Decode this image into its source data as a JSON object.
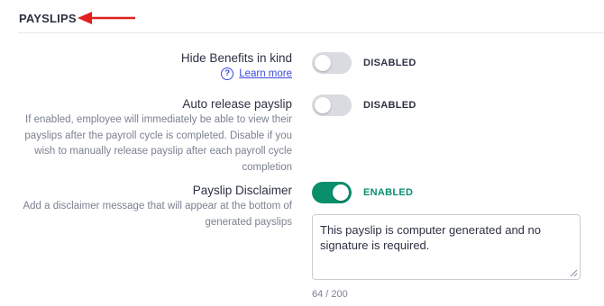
{
  "section": {
    "title": "PAYSLIPS"
  },
  "settings": {
    "hide_benefits": {
      "title": "Hide Benefits in kind",
      "learn_more": "Learn more",
      "help_glyph": "?",
      "enabled": false,
      "status": "DISABLED"
    },
    "auto_release": {
      "title": "Auto release payslip",
      "description_lines": [
        "If enabled, employee will immediately be able to view their",
        "payslips after the payroll cycle is completed. Disable if you",
        "wish to manually release payslip after each payroll cycle",
        "completion"
      ],
      "enabled": false,
      "status": "DISABLED"
    },
    "disclaimer": {
      "title": "Payslip Disclaimer",
      "description_lines": [
        "Add a disclaimer message that will appear at the bottom of",
        "generated payslips"
      ],
      "enabled": true,
      "status": "ENABLED",
      "message": "This payslip is computer generated and no signature is required.",
      "char_count": "64 / 200"
    }
  },
  "colors": {
    "accent_green": "#0a8f6c",
    "link_blue": "#3b4bd8",
    "annotation_arrow_red": "#e0201f",
    "toggle_off": "#d9dbe0"
  },
  "icons": {
    "annotation": "red-arrow-left-icon",
    "help": "question-circle-icon",
    "resize": "resize-grip-icon"
  }
}
